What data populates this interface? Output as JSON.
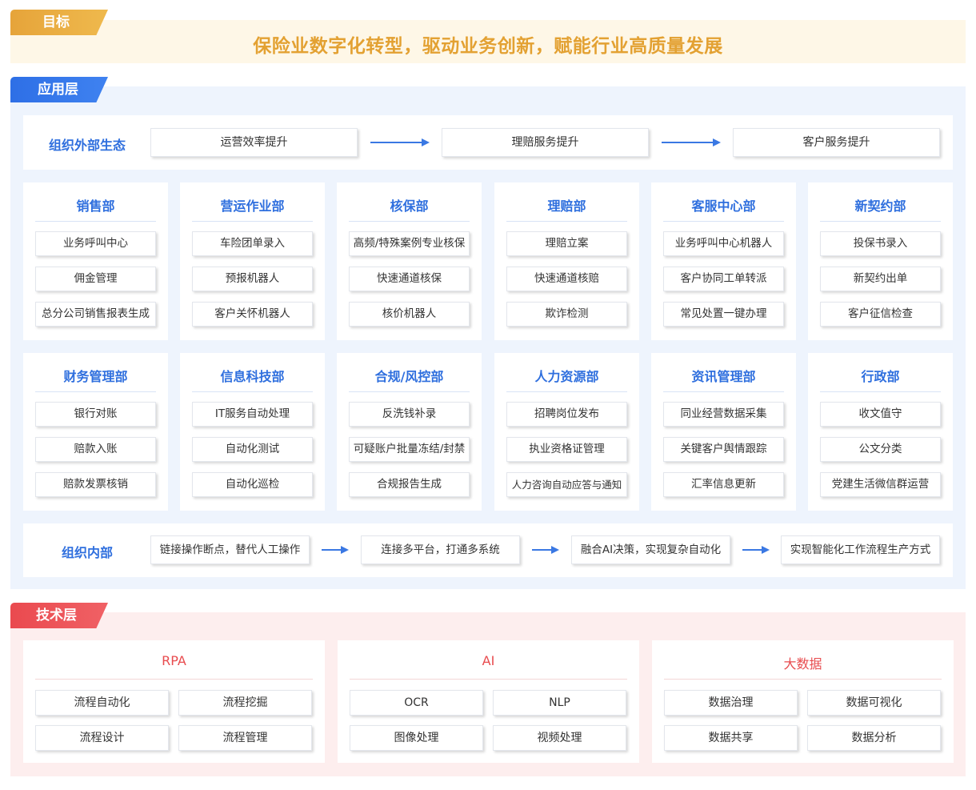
{
  "goal": {
    "tag": "目标",
    "text": "保险业数字化转型，驱动业务创新，赋能行业高质量发展"
  },
  "application": {
    "tag": "应用层",
    "external": {
      "label": "组织外部生态",
      "steps": [
        "运营效率提升",
        "理赔服务提升",
        "客户服务提升"
      ]
    },
    "departments_row1": [
      {
        "title": "销售部",
        "items": [
          "业务呼叫中心",
          "佣金管理",
          "总分公司销售报表生成"
        ]
      },
      {
        "title": "营运作业部",
        "items": [
          "车险团单录入",
          "预报机器人",
          "客户关怀机器人"
        ]
      },
      {
        "title": "核保部",
        "items": [
          "高频/特殊案例专业核保",
          "快速通道核保",
          "核价机器人"
        ]
      },
      {
        "title": "理赔部",
        "items": [
          "理赔立案",
          "快速通道核赔",
          "欺诈检测"
        ]
      },
      {
        "title": "客服中心部",
        "items": [
          "业务呼叫中心机器人",
          "客户协同工单转派",
          "常见处置一键办理"
        ]
      },
      {
        "title": "新契约部",
        "items": [
          "投保书录入",
          "新契约出单",
          "客户征信检查"
        ]
      }
    ],
    "departments_row2": [
      {
        "title": "财务管理部",
        "items": [
          "银行对账",
          "赔款入账",
          "赔款发票核销"
        ]
      },
      {
        "title": "信息科技部",
        "items": [
          "IT服务自动处理",
          "自动化测试",
          "自动化巡检"
        ]
      },
      {
        "title": "合规/风控部",
        "items": [
          "反洗钱补录",
          "可疑账户批量冻结/封禁",
          "合规报告生成"
        ]
      },
      {
        "title": "人力资源部",
        "items": [
          "招聘岗位发布",
          "执业资格证管理",
          "人力咨询自动应答与通知"
        ]
      },
      {
        "title": "资讯管理部",
        "items": [
          "同业经营数据采集",
          "关键客户舆情跟踪",
          "汇率信息更新"
        ]
      },
      {
        "title": "行政部",
        "items": [
          "收文值守",
          "公文分类",
          "党建生活微信群运营"
        ]
      }
    ],
    "internal": {
      "label": "组织内部",
      "steps": [
        "链接操作断点，替代人工操作",
        "连接多平台，打通多系统",
        "融合AI决策，实现复杂自动化",
        "实现智能化工作流程生产方式"
      ]
    }
  },
  "technology": {
    "tag": "技术层",
    "groups": [
      {
        "title": "RPA",
        "items": [
          "流程自动化",
          "流程挖掘",
          "流程设计",
          "流程管理"
        ]
      },
      {
        "title": "AI",
        "items": [
          "OCR",
          "NLP",
          "图像处理",
          "视频处理"
        ]
      },
      {
        "title": "大数据",
        "items": [
          "数据治理",
          "数据可视化",
          "数据共享",
          "数据分析"
        ]
      }
    ]
  },
  "colors": {
    "goal_accent": "#e3a132",
    "app_accent": "#2f6fde",
    "tech_accent": "#e84c4f"
  }
}
